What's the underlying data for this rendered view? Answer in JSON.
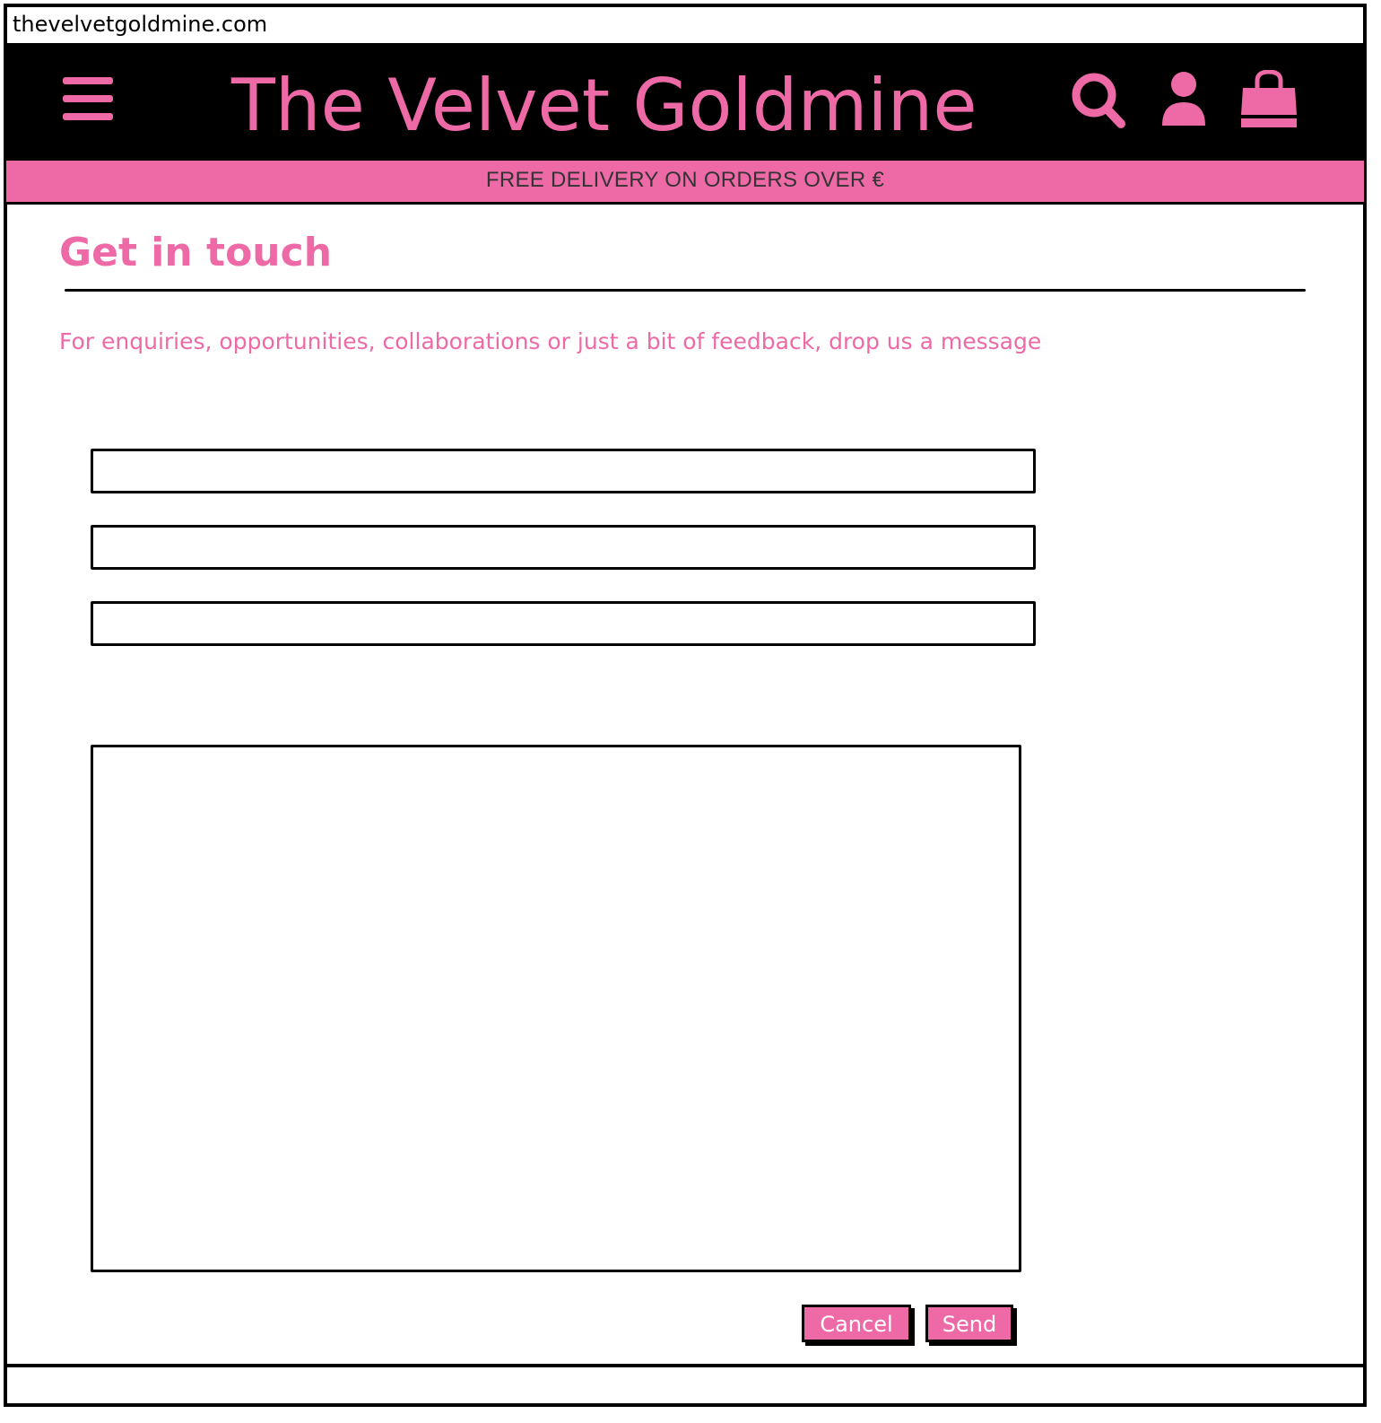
{
  "browser": {
    "url": "thevelvetgoldmine.com"
  },
  "header": {
    "site_title": "The Velvet Goldmine",
    "icons": [
      "menu-icon",
      "search-icon",
      "user-icon",
      "shopping-bag-icon"
    ]
  },
  "promo": {
    "text": "FREE DELIVERY ON ORDERS OVER €"
  },
  "contact": {
    "heading": "Get in touch",
    "intro": "For enquiries, opportunities, collaborations or just a bit of feedback, drop us a message",
    "fields": [
      {
        "value": "",
        "placeholder": ""
      },
      {
        "value": "",
        "placeholder": ""
      },
      {
        "value": "",
        "placeholder": ""
      }
    ],
    "message": {
      "value": "",
      "placeholder": ""
    },
    "cancel_label": "Cancel",
    "send_label": "Send"
  },
  "colors": {
    "accent": "#ee6aa7",
    "header_bg": "#000000",
    "border": "#000000"
  }
}
